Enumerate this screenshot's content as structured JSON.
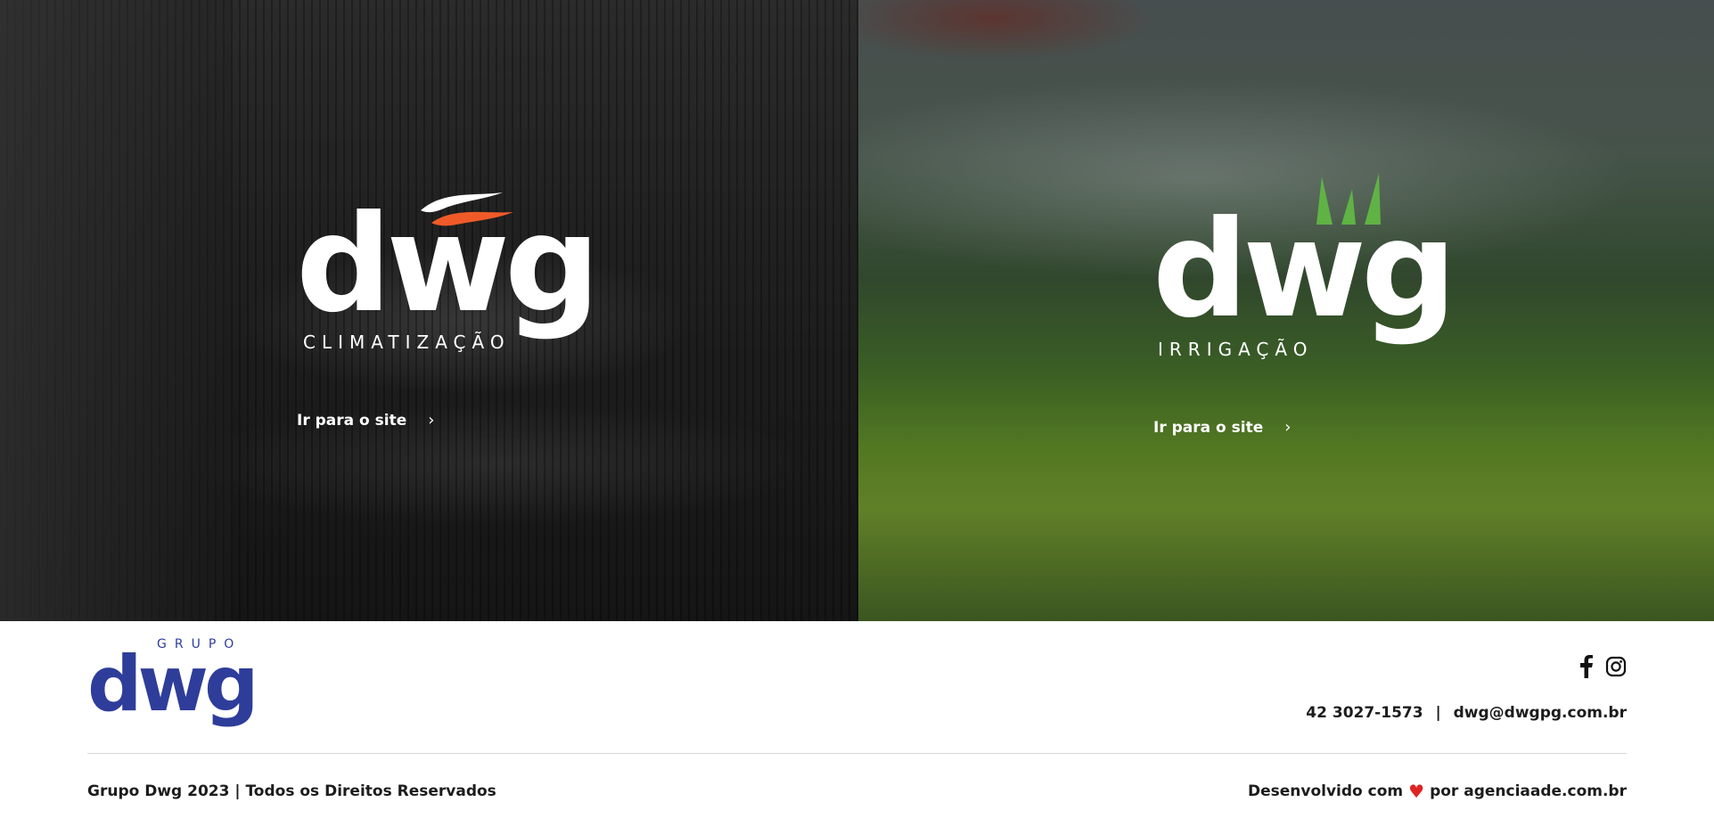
{
  "hero": {
    "climatizacao": {
      "logo_word": "dwg",
      "logo_sub": "CLIMATIZAÇÃO",
      "cta_label": "Ir para o site",
      "accent_color": "#f05a28"
    },
    "irrigacao": {
      "logo_word": "dwg",
      "logo_sub": "IRRIGAÇÃO",
      "cta_label": "Ir para o site",
      "accent_color": "#5fb344"
    }
  },
  "footer": {
    "grupo_label": "GRUPO",
    "grupo_word": "dwg",
    "brand_color": "#2e3d9a",
    "social": [
      "facebook-icon",
      "instagram-icon"
    ],
    "phone": "42 3027-1573",
    "separator": "|",
    "email": "dwg@dwgpg.com.br",
    "copyright": "Grupo Dwg 2023 | Todos os Direitos Reservados",
    "credit_prefix": "Desenvolvido com",
    "credit_suffix": "por agenciaade.com.br"
  }
}
